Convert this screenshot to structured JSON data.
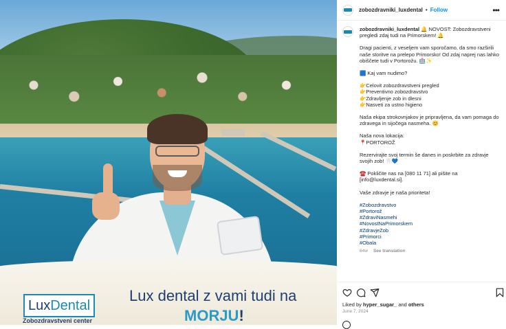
{
  "post_image": {
    "logo": {
      "part1": "Lux",
      "part2": "Dental"
    },
    "logo_subtitle": "Zobozdravstveni center",
    "headline_line1": "Lux dental z vami tudi na",
    "headline_line2_accent": "MORJU",
    "headline_line2_end": "!"
  },
  "header": {
    "username": "zobozdravniki_luxdental",
    "separator": "•",
    "follow_label": "Follow",
    "more_icon": "more-horizontal-icon"
  },
  "caption": {
    "username": "zobozdravniki_luxdental",
    "first_line": "🔔 NOVOST: Zobozdravstveni pregledi zdaj tudi na Primorskem! 🔔",
    "intro": "Dragi pacienti, z veseljem vam sporočamo, da smo razširili naše storitve na prelepo Primorsko! Od zdaj naprej nas lahko obiščete tudi v Portorožu. 🏥✨",
    "offer_title": "🟦 Kaj vam nudimo?",
    "services": [
      "👉Celovit zobozdravstveni pregled",
      "👉Preventivno zobozdravstvo",
      "👉Zdravljenje zob in dlesni",
      "👉Nasveti za ustno higieno"
    ],
    "team": "Naša ekipa strokovnjakov je pripravljena, da vam pomaga do zdravega in sijočega nasmeha. 😊",
    "location_title": "Naša nova lokacija:",
    "location": "📍PORTOROŽ",
    "booking": "Rezervirajte svoj termin še danes in poskrbite za zdravje svojih zob! 🦷💙",
    "contact": "☎️ Pokličite nas na [080 11 71] ali pišite na [info@luxdental.si].",
    "closing": "Vaše zdravje je naša prioriteta!",
    "hashtags": [
      "#Zobozdravstvo",
      "#Portorož",
      "#ZdraviNasmehi",
      "#NovostNaPrimorskem",
      "#ZdravjeZob",
      "#Primorci",
      "#Obala"
    ],
    "age": "64w",
    "see_translation": "See translation"
  },
  "footer": {
    "liked_by_prefix": "Liked by ",
    "liked_by_user": "hyper_sugar_",
    "liked_by_and": " and ",
    "liked_by_others": "others",
    "date": "June 7, 2024"
  },
  "colors": {
    "accent": "#0095f6",
    "brand_dark": "#1f3f6e",
    "brand_light": "#2a9bc7",
    "hashtag": "#00376b"
  }
}
